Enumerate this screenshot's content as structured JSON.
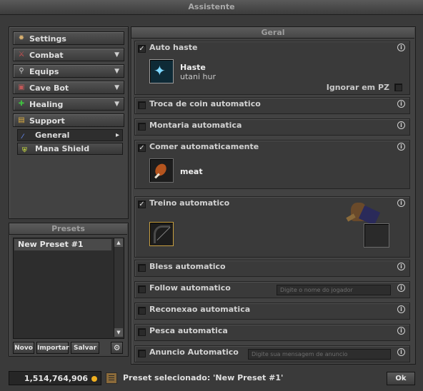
{
  "window": {
    "title": "Assistente"
  },
  "sidebar": {
    "items": [
      {
        "label": "Settings",
        "icon": "gear-icon",
        "has_arrow": false
      },
      {
        "label": "Combat",
        "icon": "sword-icon",
        "has_arrow": true
      },
      {
        "label": "Equips",
        "icon": "equip-icon",
        "has_arrow": true
      },
      {
        "label": "Cave Bot",
        "icon": "map-icon",
        "has_arrow": true
      },
      {
        "label": "Healing",
        "icon": "heal-icon",
        "has_arrow": true
      },
      {
        "label": "Support",
        "icon": "scroll-icon",
        "has_arrow": false
      }
    ],
    "subitems": [
      {
        "label": "General",
        "icon": "wand-icon",
        "has_arrow": true
      },
      {
        "label": "Mana Shield",
        "icon": "shield-icon",
        "has_arrow": false
      }
    ],
    "arrow": "▼",
    "sub_arrow": "▸"
  },
  "presets": {
    "header": "Presets",
    "items": [
      "New Preset #1"
    ],
    "buttons": {
      "new": "Novo",
      "import": "Importar",
      "save": "Salvar"
    }
  },
  "main": {
    "header": "Geral",
    "info_glyph": "i",
    "rows": {
      "auto_haste": {
        "label": "Auto haste",
        "checked": true,
        "spell_name": "Haste",
        "spell_words": "utani hur",
        "ignore_pz": "Ignorar em PZ"
      },
      "coin": {
        "label": "Troca de coin automatico",
        "checked": false
      },
      "mount": {
        "label": "Montaria automatica",
        "checked": false
      },
      "eat": {
        "label": "Comer automaticamente",
        "checked": true,
        "food": "meat"
      },
      "train": {
        "label": "Treino automatico",
        "checked": true
      },
      "bless": {
        "label": "Bless automatico",
        "checked": false
      },
      "follow": {
        "label": "Follow automatico",
        "checked": false,
        "placeholder": "Digite o nome do jogador"
      },
      "reconnect": {
        "label": "Reconexao automatica",
        "checked": false
      },
      "fish": {
        "label": "Pesca automatica",
        "checked": false
      },
      "advert": {
        "label": "Anuncio Automatico",
        "checked": false,
        "placeholder": "Digite sua mensagem de anuncio"
      }
    }
  },
  "footer": {
    "gold": "1,514,764,906",
    "preset_text": "Preset selecionado: 'New Preset #1'",
    "ok": "Ok"
  },
  "colors": {
    "check": "#e0e0e0",
    "gold": "#f0b020"
  }
}
